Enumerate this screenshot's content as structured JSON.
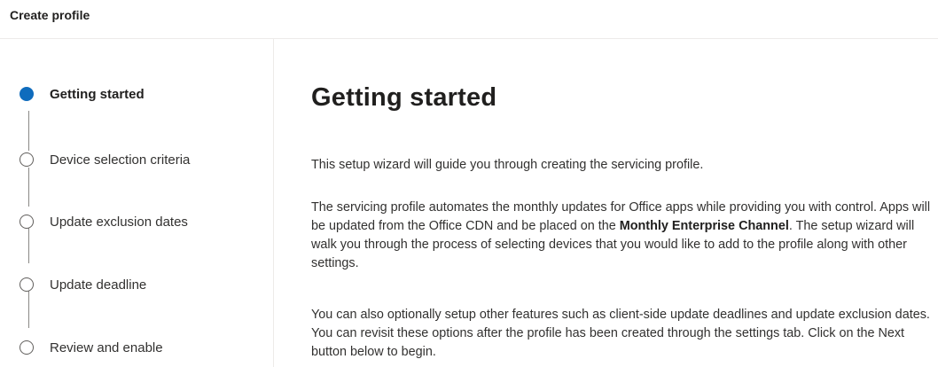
{
  "header": {
    "title": "Create profile"
  },
  "steps": [
    {
      "label": "Getting started",
      "state": "active"
    },
    {
      "label": "Device selection criteria",
      "state": "inactive"
    },
    {
      "label": "Update exclusion dates",
      "state": "inactive"
    },
    {
      "label": "Update deadline",
      "state": "inactive"
    },
    {
      "label": "Review and enable",
      "state": "inactive"
    }
  ],
  "main": {
    "title": "Getting started",
    "intro": "This setup wizard will guide you through creating the servicing profile.",
    "para2": {
      "part1": "The servicing profile automates the monthly updates for Office apps while providing you with control. Apps will be updated from the Office CDN and be placed on the ",
      "bold": "Monthly Enterprise Channel",
      "part2": ". The setup wizard will walk you through the process of selecting devices that you would like to add to the profile along with other settings."
    },
    "para3": "You can also optionally setup other features such as client-side update deadlines and update exclusion dates. You can revisit these options after the profile has been created through the settings tab. Click on the Next button below to begin."
  },
  "colors": {
    "accent": "#0f6cbd",
    "divider": "#edebe9",
    "text": "#323130"
  }
}
